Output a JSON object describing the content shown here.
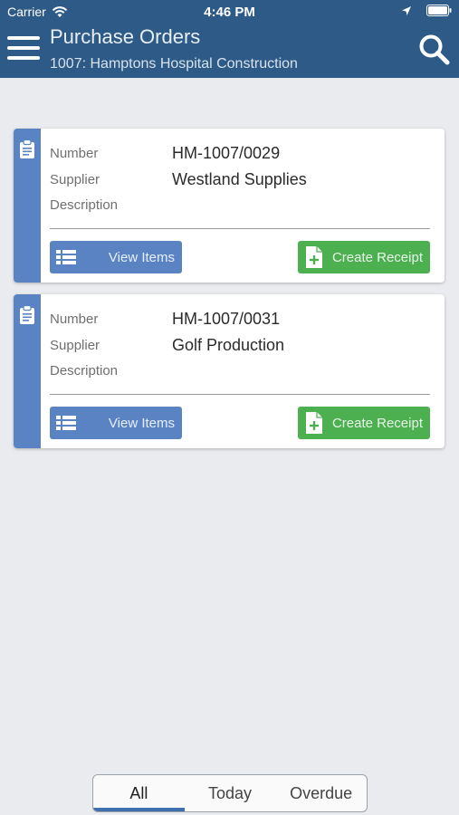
{
  "status": {
    "carrier": "Carrier",
    "time": "4:46 PM"
  },
  "header": {
    "title": "Purchase Orders",
    "subtitle": "1007: Hamptons Hospital Construction"
  },
  "labels": {
    "number": "Number",
    "supplier": "Supplier",
    "description": "Description",
    "view_items": "View Items",
    "create_receipt": "Create Receipt"
  },
  "orders": [
    {
      "number": "HM-1007/0029",
      "supplier": "Westland Supplies",
      "description": ""
    },
    {
      "number": "HM-1007/0031",
      "supplier": "Golf Production",
      "description": ""
    }
  ],
  "filters": {
    "options": [
      "All",
      "Today",
      "Overdue"
    ],
    "selected": "All"
  },
  "colors": {
    "header": "#2d5a86",
    "accent_blue": "#5a83c4",
    "accent_green": "#4caf50",
    "background": "#e9ebee"
  }
}
